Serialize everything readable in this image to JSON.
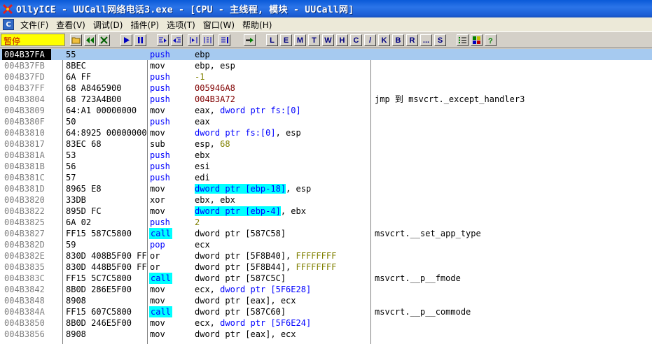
{
  "window": {
    "title": "OllyICE - UUCall网络电话3.exe - [CPU -  主线程, 模块 - UUCall网]"
  },
  "menu": {
    "items": [
      "文件(F)",
      "查看(V)",
      "调试(D)",
      "插件(P)",
      "选项(T)",
      "窗口(W)",
      "帮助(H)"
    ]
  },
  "toolbar": {
    "status": "暂停",
    "letter_buttons": [
      "L",
      "E",
      "M",
      "T",
      "W",
      "H",
      "C",
      "/",
      "K",
      "B",
      "R",
      "...",
      "S"
    ]
  },
  "disasm": {
    "rows": [
      {
        "addr": "004B37FA",
        "hex": "55",
        "mnem": "push",
        "opnd": "ebp",
        "cmt": ""
      },
      {
        "addr": "004B37FB",
        "hex": "8BEC",
        "mnem": "mov",
        "opnd": "ebp, esp",
        "cmt": ""
      },
      {
        "addr": "004B37FD",
        "hex": "6A FF",
        "mnem": "push",
        "opnd": "-1",
        "cmt": ""
      },
      {
        "addr": "004B37FF",
        "hex": "68 A8465900",
        "mnem": "push",
        "opnd": "005946A8",
        "cmt": ""
      },
      {
        "addr": "004B3804",
        "hex": "68 723A4B00",
        "mnem": "push",
        "opnd": "004B3A72",
        "cmt": "jmp 到 msvcrt._except_handler3"
      },
      {
        "addr": "004B3809",
        "hex": "64:A1 00000000",
        "mnem": "mov",
        "opnd": "eax, dword ptr fs:[0]",
        "cmt": ""
      },
      {
        "addr": "004B380F",
        "hex": "50",
        "mnem": "push",
        "opnd": "eax",
        "cmt": ""
      },
      {
        "addr": "004B3810",
        "hex": "64:8925 00000000",
        "mnem": "mov",
        "opnd": "dword ptr fs:[0], esp",
        "cmt": ""
      },
      {
        "addr": "004B3817",
        "hex": "83EC 68",
        "mnem": "sub",
        "opnd": "esp, 68",
        "cmt": ""
      },
      {
        "addr": "004B381A",
        "hex": "53",
        "mnem": "push",
        "opnd": "ebx",
        "cmt": ""
      },
      {
        "addr": "004B381B",
        "hex": "56",
        "mnem": "push",
        "opnd": "esi",
        "cmt": ""
      },
      {
        "addr": "004B381C",
        "hex": "57",
        "mnem": "push",
        "opnd": "edi",
        "cmt": ""
      },
      {
        "addr": "004B381D",
        "hex": "8965 E8",
        "mnem": "mov",
        "opnd": "dword ptr [ebp-18], esp",
        "cmt": ""
      },
      {
        "addr": "004B3820",
        "hex": "33DB",
        "mnem": "xor",
        "opnd": "ebx, ebx",
        "cmt": ""
      },
      {
        "addr": "004B3822",
        "hex": "895D FC",
        "mnem": "mov",
        "opnd": "dword ptr [ebp-4], ebx",
        "cmt": ""
      },
      {
        "addr": "004B3825",
        "hex": "6A 02",
        "mnem": "push",
        "opnd": "2",
        "cmt": ""
      },
      {
        "addr": "004B3827",
        "hex": "FF15 587C5800",
        "mnem": "call",
        "opnd": "dword ptr [587C58]",
        "cmt": "msvcrt.__set_app_type"
      },
      {
        "addr": "004B382D",
        "hex": "59",
        "mnem": "pop",
        "opnd": "ecx",
        "cmt": ""
      },
      {
        "addr": "004B382E",
        "hex": "830D 408B5F00 FF",
        "mnem": "or",
        "opnd": "dword ptr [5F8B40], FFFFFFFF",
        "cmt": ""
      },
      {
        "addr": "004B3835",
        "hex": "830D 448B5F00 FF",
        "mnem": "or",
        "opnd": "dword ptr [5F8B44], FFFFFFFF",
        "cmt": ""
      },
      {
        "addr": "004B383C",
        "hex": "FF15 5C7C5800",
        "mnem": "call",
        "opnd": "dword ptr [587C5C]",
        "cmt": "msvcrt.__p__fmode"
      },
      {
        "addr": "004B3842",
        "hex": "8B0D 286E5F00",
        "mnem": "mov",
        "opnd": "ecx, dword ptr [5F6E28]",
        "cmt": ""
      },
      {
        "addr": "004B3848",
        "hex": "8908",
        "mnem": "mov",
        "opnd": "dword ptr [eax], ecx",
        "cmt": ""
      },
      {
        "addr": "004B384A",
        "hex": "FF15 607C5800",
        "mnem": "call",
        "opnd": "dword ptr [587C60]",
        "cmt": "msvcrt.__p__commode"
      },
      {
        "addr": "004B3850",
        "hex": "8B0D 246E5F00",
        "mnem": "mov",
        "opnd": "ecx, dword ptr [5F6E24]",
        "cmt": ""
      },
      {
        "addr": "004B3856",
        "hex": "8908",
        "mnem": "mov",
        "opnd": "dword ptr [eax], ecx",
        "cmt": ""
      }
    ]
  }
}
